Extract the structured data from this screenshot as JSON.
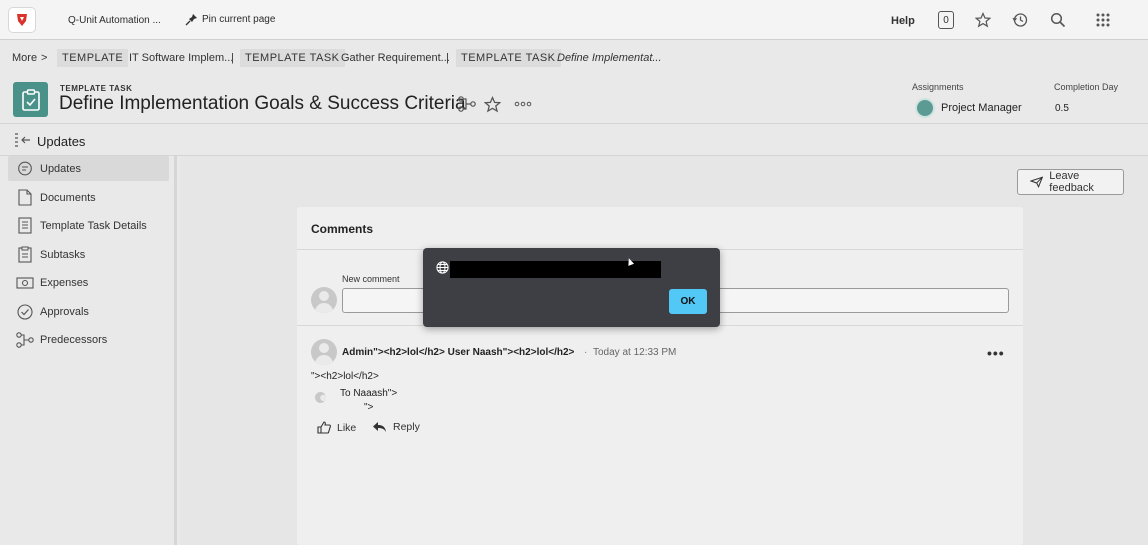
{
  "topbar": {
    "app_title": "Q-Unit Automation ...",
    "pin_label": "Pin current page",
    "help_label": "Help",
    "notification_count": "0"
  },
  "breadcrumbs": {
    "more": "More",
    "more_chevron": ">",
    "chip1": "TEMPLATE",
    "item1": "IT Software Implem...",
    "sep1": "|",
    "chip2": "TEMPLATE TASK",
    "item2": "Gather Requirement...",
    "sep2": "|",
    "chip3": "TEMPLATE TASK",
    "item3": "Define Implementat..."
  },
  "header": {
    "task_type": "TEMPLATE TASK",
    "task_title": "Define Implementation Goals & Success Criteria",
    "assignments_label": "Assignments",
    "assignee": "Project Manager",
    "completion_label": "Completion Day",
    "completion_value": "0.5"
  },
  "updates_bar": {
    "title": "Updates"
  },
  "sidebar": {
    "items": [
      {
        "label": "Updates",
        "icon": "comment-icon",
        "active": true
      },
      {
        "label": "Documents",
        "icon": "document-icon",
        "active": false
      },
      {
        "label": "Template Task Details",
        "icon": "details-icon",
        "active": false
      },
      {
        "label": "Subtasks",
        "icon": "subtasks-icon",
        "active": false
      },
      {
        "label": "Expenses",
        "icon": "money-icon",
        "active": false
      },
      {
        "label": "Approvals",
        "icon": "check-circle-icon",
        "active": false
      },
      {
        "label": "Predecessors",
        "icon": "predecessors-icon",
        "active": false
      }
    ]
  },
  "main": {
    "feedback_label": "Leave feedback",
    "comments_title": "Comments",
    "new_comment_label": "New comment",
    "comment": {
      "author": "Admin\"><h2>lol</h2> User Naash\"><h2>lol</h2>",
      "dot": "·",
      "time": "Today at 12:33 PM",
      "body": "\"><h2>lol</h2>",
      "to_line": "To Naaash\">",
      "to_line2": "\">",
      "like_label": "Like",
      "reply_label": "Reply"
    }
  },
  "dialog": {
    "ok_label": "OK"
  },
  "colors": {
    "accent": "#51c8f5",
    "task_icon": "#4a9289",
    "dialog_bg": "#3e3e45"
  }
}
